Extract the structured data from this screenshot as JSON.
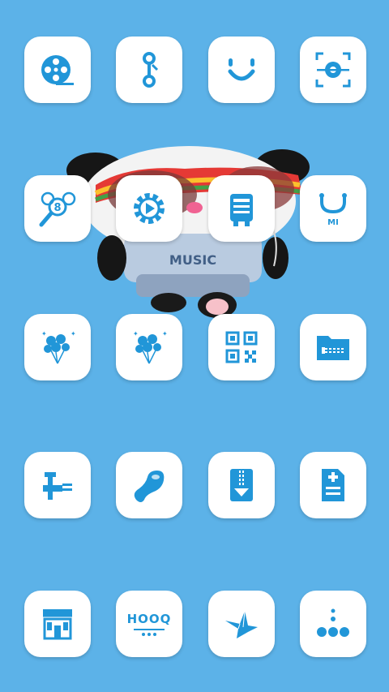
{
  "colors": {
    "background": "#5cb2e8",
    "tile": "#ffffff",
    "icon": "#2196d8"
  },
  "wallpaper": {
    "name": "panda-mascot-wallpaper"
  },
  "apps": [
    {
      "id": "film-reel",
      "icon": "film-reel-icon"
    },
    {
      "id": "connector",
      "icon": "connector-icon"
    },
    {
      "id": "smile",
      "icon": "smile-face-icon"
    },
    {
      "id": "scanner",
      "icon": "scan-eye-icon"
    },
    {
      "id": "pool-balls",
      "icon": "pool-balls-icon"
    },
    {
      "id": "settings-player",
      "icon": "gear-play-icon"
    },
    {
      "id": "robot",
      "icon": "robot-icon"
    },
    {
      "id": "mi-headset",
      "icon": "mi-headset-icon",
      "label": "MI"
    },
    {
      "id": "balloons-1",
      "icon": "balloons-icon"
    },
    {
      "id": "balloons-2",
      "icon": "balloons-icon"
    },
    {
      "id": "qr-code",
      "icon": "qr-code-icon"
    },
    {
      "id": "zip-folder",
      "icon": "zip-folder-icon"
    },
    {
      "id": "faucet",
      "icon": "faucet-icon"
    },
    {
      "id": "bean",
      "icon": "bean-icon"
    },
    {
      "id": "zip-download",
      "icon": "zip-download-icon"
    },
    {
      "id": "medical-report",
      "icon": "medical-report-icon"
    },
    {
      "id": "store",
      "icon": "store-icon"
    },
    {
      "id": "hooq",
      "icon": "hooq-logo-icon",
      "label": "HOOQ"
    },
    {
      "id": "origami-bird",
      "icon": "origami-bird-icon"
    },
    {
      "id": "dots",
      "icon": "dots-icon"
    }
  ]
}
